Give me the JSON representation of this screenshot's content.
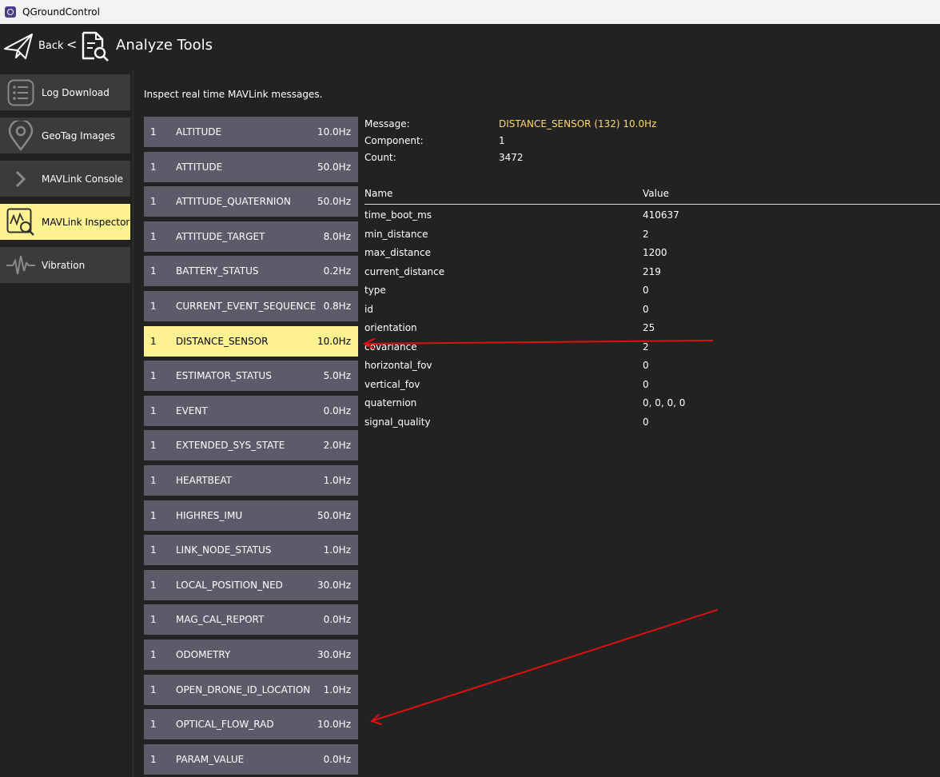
{
  "window": {
    "title": "QGroundControl"
  },
  "header": {
    "back_label": "Back",
    "separator": "<",
    "title": "Analyze Tools"
  },
  "sidebar": {
    "items": [
      {
        "label": "Log Download",
        "icon": "list-icon",
        "active": false
      },
      {
        "label": "GeoTag Images",
        "icon": "map-pin-icon",
        "active": false
      },
      {
        "label": "MAVLink Console",
        "icon": "chevron-right-icon",
        "active": false
      },
      {
        "label": "MAVLink Inspector",
        "icon": "inspector-icon",
        "active": true
      },
      {
        "label": "Vibration",
        "icon": "waveform-icon",
        "active": false
      }
    ]
  },
  "main": {
    "intro": "Inspect real time MAVLink messages.",
    "messages": [
      {
        "comp": "1",
        "name": "ALTITUDE",
        "rate": "10.0Hz"
      },
      {
        "comp": "1",
        "name": "ATTITUDE",
        "rate": "50.0Hz"
      },
      {
        "comp": "1",
        "name": "ATTITUDE_QUATERNION",
        "rate": "50.0Hz"
      },
      {
        "comp": "1",
        "name": "ATTITUDE_TARGET",
        "rate": "8.0Hz"
      },
      {
        "comp": "1",
        "name": "BATTERY_STATUS",
        "rate": "0.2Hz"
      },
      {
        "comp": "1",
        "name": "CURRENT_EVENT_SEQUENCE",
        "rate": "0.8Hz"
      },
      {
        "comp": "1",
        "name": "DISTANCE_SENSOR",
        "rate": "10.0Hz"
      },
      {
        "comp": "1",
        "name": "ESTIMATOR_STATUS",
        "rate": "5.0Hz"
      },
      {
        "comp": "1",
        "name": "EVENT",
        "rate": "0.0Hz"
      },
      {
        "comp": "1",
        "name": "EXTENDED_SYS_STATE",
        "rate": "2.0Hz"
      },
      {
        "comp": "1",
        "name": "HEARTBEAT",
        "rate": "1.0Hz"
      },
      {
        "comp": "1",
        "name": "HIGHRES_IMU",
        "rate": "50.0Hz"
      },
      {
        "comp": "1",
        "name": "LINK_NODE_STATUS",
        "rate": "1.0Hz"
      },
      {
        "comp": "1",
        "name": "LOCAL_POSITION_NED",
        "rate": "30.0Hz"
      },
      {
        "comp": "1",
        "name": "MAG_CAL_REPORT",
        "rate": "0.0Hz"
      },
      {
        "comp": "1",
        "name": "ODOMETRY",
        "rate": "30.0Hz"
      },
      {
        "comp": "1",
        "name": "OPEN_DRONE_ID_LOCATION",
        "rate": "1.0Hz"
      },
      {
        "comp": "1",
        "name": "OPTICAL_FLOW_RAD",
        "rate": "10.0Hz"
      },
      {
        "comp": "1",
        "name": "PARAM_VALUE",
        "rate": "0.0Hz"
      }
    ],
    "selected_index": 6,
    "detail": {
      "message_label": "Message:",
      "message_value": "DISTANCE_SENSOR (132) 10.0Hz",
      "component_label": "Component:",
      "component_value": "1",
      "count_label": "Count:",
      "count_value": "3472",
      "col_name": "Name",
      "col_value": "Value",
      "fields": [
        {
          "name": "time_boot_ms",
          "value": "410637"
        },
        {
          "name": "min_distance",
          "value": "2"
        },
        {
          "name": "max_distance",
          "value": "1200"
        },
        {
          "name": "current_distance",
          "value": "219"
        },
        {
          "name": "type",
          "value": "0"
        },
        {
          "name": "id",
          "value": "0"
        },
        {
          "name": "orientation",
          "value": "25"
        },
        {
          "name": "covariance",
          "value": "2"
        },
        {
          "name": "horizontal_fov",
          "value": "0"
        },
        {
          "name": "vertical_fov",
          "value": "0"
        },
        {
          "name": "quaternion",
          "value": "0, 0, 0, 0"
        },
        {
          "name": "signal_quality",
          "value": "0"
        }
      ]
    }
  },
  "colors": {
    "background": "#222222",
    "row": "#5d5b6a",
    "selected": "#fff291",
    "highlight_text": "#ffd86b",
    "annotation_arrow": "#e01010"
  }
}
